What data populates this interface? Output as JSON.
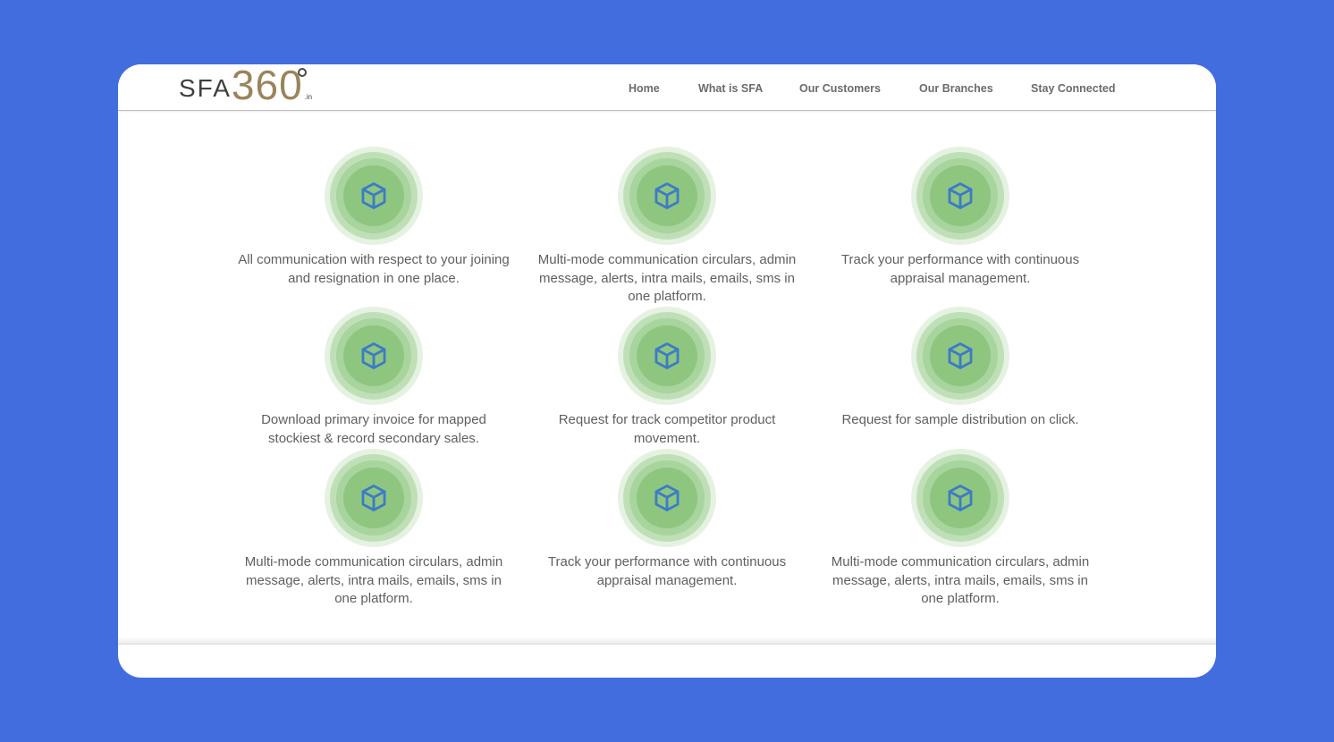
{
  "brand": {
    "logo_sfa": "SFA",
    "logo_num": "360",
    "logo_tld": ".in"
  },
  "nav": {
    "items": [
      {
        "label": "Home"
      },
      {
        "label": "What is SFA"
      },
      {
        "label": "Our Customers"
      },
      {
        "label": "Our Branches"
      },
      {
        "label": "Stay Connected"
      }
    ]
  },
  "features": [
    {
      "icon": "cube-icon",
      "text": "All communication with respect to your joining and resignation in one place."
    },
    {
      "icon": "cube-icon",
      "text": "Multi-mode communication circulars, admin message, alerts, intra mails, emails, sms in one platform."
    },
    {
      "icon": "cube-icon",
      "text": "Track your performance with continuous appraisal management."
    },
    {
      "icon": "cube-icon",
      "text": "Download primary invoice for mapped stockiest & record secondary sales."
    },
    {
      "icon": "cube-icon",
      "text": "Request for track competitor product movement."
    },
    {
      "icon": "cube-icon",
      "text": "Request for sample distribution on click."
    },
    {
      "icon": "cube-icon",
      "text": "Multi-mode communication circulars, admin message, alerts, intra mails, emails, sms in one platform."
    },
    {
      "icon": "cube-icon",
      "text": "Track your performance with continuous appraisal management."
    },
    {
      "icon": "cube-icon",
      "text": "Multi-mode communication circulars, admin message, alerts, intra mails, emails, sms in one platform."
    }
  ],
  "colors": {
    "background": "#416ddf",
    "logo_accent": "#9a845a",
    "icon_blue": "#3d7bc7",
    "icon_green": "#8fc67f"
  }
}
